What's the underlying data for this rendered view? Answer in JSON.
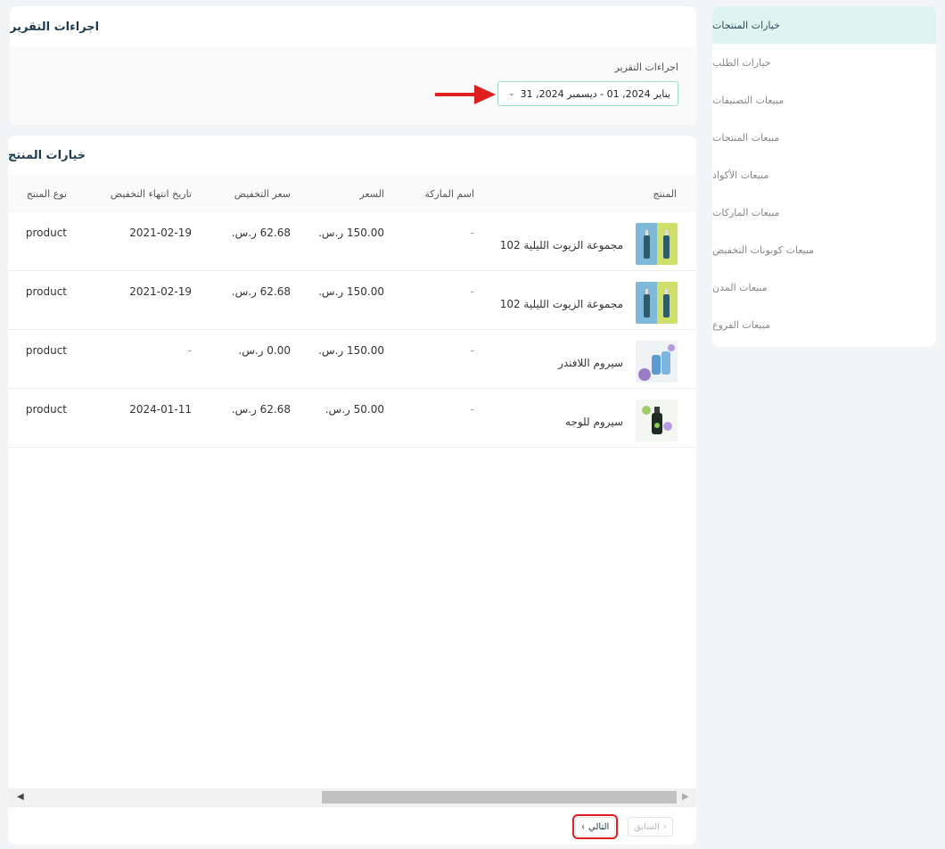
{
  "sidebar": {
    "items": [
      {
        "label": "خيارات المنتجات",
        "active": true
      },
      {
        "label": "خيارات الطلب"
      },
      {
        "label": "مبيعات التصنيفات"
      },
      {
        "label": "مبيعات المنتجات"
      },
      {
        "label": "مبيعات الأكواد"
      },
      {
        "label": "مبيعات الماركات"
      },
      {
        "label": "مبيعات كوبونات التخفيض"
      },
      {
        "label": "مبيعات المدن"
      },
      {
        "label": "مبيعات الفروع"
      }
    ]
  },
  "report": {
    "title": "اجراءات التقرير",
    "field_label": "اجراءات التقرير",
    "date_range": "يناير 2024, 01 - ديسمبر 2024, 31",
    "chevron_icon": "chevron-down-icon"
  },
  "products": {
    "title": "خيارات المنتج",
    "columns": {
      "product": "المنتج",
      "brand": "اسم الماركة",
      "price": "السعر",
      "discount_price": "سعر التخفيض",
      "discount_end": "تاريخ انتهاء التخفيض",
      "type": "نوع المنتج"
    },
    "rows": [
      {
        "name": "مجموعة الزيوت الليلية 102",
        "brand": "-",
        "price": "150.00 ر.س.",
        "discount_price": "62.68 ر.س.",
        "discount_end": "2021-02-19",
        "type": "product",
        "image": "oil-bottles-image"
      },
      {
        "name": "مجموعة الزيوت الليلية 102",
        "brand": "-",
        "price": "150.00 ر.س.",
        "discount_price": "62.68 ر.س.",
        "discount_end": "2021-02-19",
        "type": "product",
        "image": "oil-bottles-image"
      },
      {
        "name": "سيروم اللافندر",
        "brand": "-",
        "price": "150.00 ر.س.",
        "discount_price": "0.00 ر.س.",
        "discount_end": "-",
        "type": "product",
        "image": "lavender-serum-image"
      },
      {
        "name": "سيروم للوجه",
        "brand": "-",
        "price": "50.00 ر.س.",
        "discount_price": "62.68 ر.س.",
        "discount_end": "2024-01-11",
        "type": "product",
        "image": "face-serum-image"
      }
    ]
  },
  "pagination": {
    "prev_label": "السابق",
    "next_label": "التالي"
  },
  "colors": {
    "active_bg": "#ddf4ef",
    "accent_border": "#9fdccd",
    "title_color": "#1d3a4e",
    "annotation_red": "#e02020"
  }
}
